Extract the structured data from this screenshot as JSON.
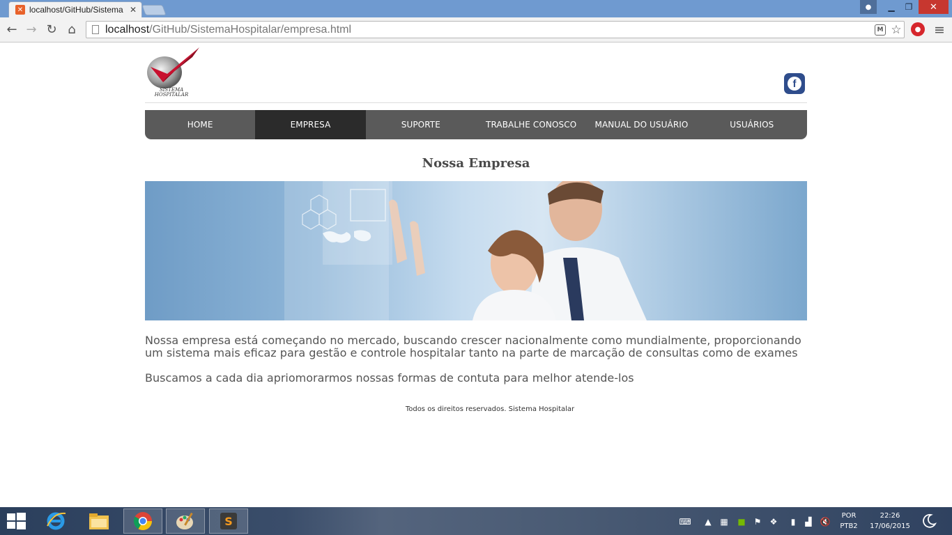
{
  "browser": {
    "tab_title": "localhost/GitHub/Sistema",
    "url_host": "localhost",
    "url_path": "/GitHub/SistemaHospitalar/empresa.html"
  },
  "site": {
    "logo_text_line1": "SISTEMA",
    "logo_text_line2": "HOSPITALAR",
    "facebook_glyph": "f",
    "nav": [
      {
        "label": "HOME",
        "active": false
      },
      {
        "label": "EMPRESA",
        "active": true
      },
      {
        "label": "SUPORTE",
        "active": false
      },
      {
        "label": "TRABALHE CONOSCO",
        "active": false
      },
      {
        "label": "MANUAL DO USUÁRIO",
        "active": false
      },
      {
        "label": "USUÁRIOS",
        "active": false
      }
    ],
    "page_title": "Nossa Empresa",
    "paragraph1": "Nossa empresa está começando no mercado, buscando crescer nacionalmente como mundialmente, proporcionando um sistema mais eficaz para gestão e controle hospitalar tanto na parte de marcação de consultas como de exames",
    "paragraph2": "Buscamos a cada dia apriomorarmos nossas formas de contuta para melhor atende-los",
    "footer": "Todos os direitos reservados. Sistema Hospitalar"
  },
  "taskbar": {
    "language": "POR",
    "keyboard": "PTB2",
    "time": "22:26",
    "date": "17/06/2015"
  },
  "colors": {
    "nav_bg": "#5a5a5a",
    "nav_active": "#2b2b2b",
    "logo_red": "#c8102e",
    "facebook_blue": "#2f4d8c"
  }
}
